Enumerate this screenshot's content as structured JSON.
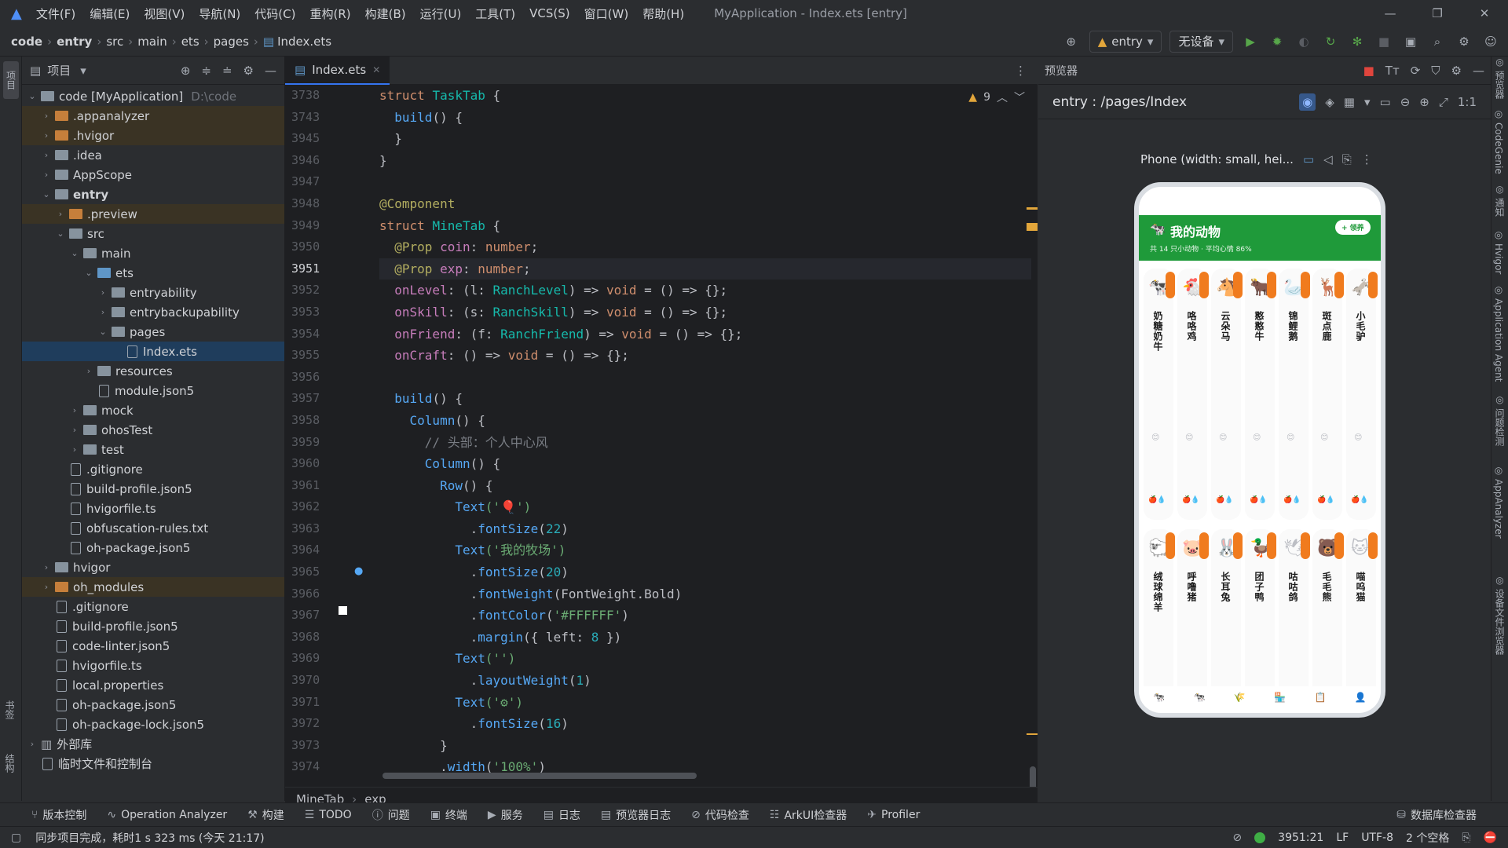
{
  "menu": {
    "items": [
      "文件(F)",
      "编辑(E)",
      "视图(V)",
      "导航(N)",
      "代码(C)",
      "重构(R)",
      "构建(B)",
      "运行(U)",
      "工具(T)",
      "VCS(S)",
      "窗口(W)",
      "帮助(H)"
    ],
    "title": "MyApplication - Index.ets [entry]"
  },
  "breadcrumb": {
    "items": [
      "code",
      "entry",
      "src",
      "main",
      "ets",
      "pages",
      "Index.ets"
    ]
  },
  "toolbar": {
    "run_config": "entry",
    "device": "无设备"
  },
  "project": {
    "header": "项目",
    "rows": [
      {
        "label": "code [MyApplication]",
        "extra": "D:\\code",
        "depth": 0,
        "chev": "v",
        "type": "folder"
      },
      {
        "label": ".appanalyzer",
        "depth": 1,
        "chev": ">",
        "type": "folder-o",
        "hl": true
      },
      {
        "label": ".hvigor",
        "depth": 1,
        "chev": ">",
        "type": "folder-o",
        "hl": true
      },
      {
        "label": ".idea",
        "depth": 1,
        "chev": ">",
        "type": "folder"
      },
      {
        "label": "AppScope",
        "depth": 1,
        "chev": ">",
        "type": "folder"
      },
      {
        "label": "entry",
        "depth": 1,
        "chev": "v",
        "type": "folder",
        "bold": true
      },
      {
        "label": ".preview",
        "depth": 2,
        "chev": ">",
        "type": "folder-o",
        "hl": true
      },
      {
        "label": "src",
        "depth": 2,
        "chev": "v",
        "type": "folder"
      },
      {
        "label": "main",
        "depth": 3,
        "chev": "v",
        "type": "folder"
      },
      {
        "label": "ets",
        "depth": 4,
        "chev": "v",
        "type": "folder-b"
      },
      {
        "label": "entryability",
        "depth": 5,
        "chev": ">",
        "type": "folder"
      },
      {
        "label": "entrybackupability",
        "depth": 5,
        "chev": ">",
        "type": "folder"
      },
      {
        "label": "pages",
        "depth": 5,
        "chev": "v",
        "type": "folder"
      },
      {
        "label": "Index.ets",
        "depth": 6,
        "chev": "",
        "type": "file",
        "sel": true
      },
      {
        "label": "resources",
        "depth": 4,
        "chev": ">",
        "type": "folder"
      },
      {
        "label": "module.json5",
        "depth": 4,
        "chev": "",
        "type": "file"
      },
      {
        "label": "mock",
        "depth": 3,
        "chev": ">",
        "type": "folder"
      },
      {
        "label": "ohosTest",
        "depth": 3,
        "chev": ">",
        "type": "folder"
      },
      {
        "label": "test",
        "depth": 3,
        "chev": ">",
        "type": "folder"
      },
      {
        "label": ".gitignore",
        "depth": 2,
        "chev": "",
        "type": "file"
      },
      {
        "label": "build-profile.json5",
        "depth": 2,
        "chev": "",
        "type": "file"
      },
      {
        "label": "hvigorfile.ts",
        "depth": 2,
        "chev": "",
        "type": "file"
      },
      {
        "label": "obfuscation-rules.txt",
        "depth": 2,
        "chev": "",
        "type": "file"
      },
      {
        "label": "oh-package.json5",
        "depth": 2,
        "chev": "",
        "type": "file"
      },
      {
        "label": "hvigor",
        "depth": 1,
        "chev": ">",
        "type": "folder"
      },
      {
        "label": "oh_modules",
        "depth": 1,
        "chev": ">",
        "type": "folder-o",
        "hl": true
      },
      {
        "label": ".gitignore",
        "depth": 1,
        "chev": "",
        "type": "file"
      },
      {
        "label": "build-profile.json5",
        "depth": 1,
        "chev": "",
        "type": "file"
      },
      {
        "label": "code-linter.json5",
        "depth": 1,
        "chev": "",
        "type": "file"
      },
      {
        "label": "hvigorfile.ts",
        "depth": 1,
        "chev": "",
        "type": "file"
      },
      {
        "label": "local.properties",
        "depth": 1,
        "chev": "",
        "type": "file"
      },
      {
        "label": "oh-package.json5",
        "depth": 1,
        "chev": "",
        "type": "file"
      },
      {
        "label": "oh-package-lock.json5",
        "depth": 1,
        "chev": "",
        "type": "file"
      },
      {
        "label": "外部库",
        "depth": 0,
        "chev": ">",
        "type": "lib"
      },
      {
        "label": "临时文件和控制台",
        "depth": 0,
        "chev": "",
        "type": "file"
      }
    ]
  },
  "editor": {
    "tab": "Index.ets",
    "warnings": "9",
    "footer": [
      "MineTab",
      "exp"
    ],
    "lines": [
      "3738",
      "3743",
      "3945",
      "3946",
      "3947",
      "3948",
      "3949",
      "3950",
      "3951",
      "3952",
      "3953",
      "3954",
      "3955",
      "3956",
      "3957",
      "3958",
      "3959",
      "3960",
      "3961",
      "3962",
      "3963",
      "3964",
      "3965",
      "3966",
      "3967",
      "3968",
      "3969",
      "3970",
      "3971",
      "3972",
      "3973",
      "3974"
    ],
    "current": "3951"
  },
  "preview": {
    "title": "预览器",
    "path": "entry : /pages/Index",
    "device": "Phone (width: small, hei...",
    "app": {
      "title": "我的动物",
      "subtitle": "共 14 只小动物 · 平均心情 86%",
      "button": "+ 领养",
      "row1": [
        {
          "name": "奶糖奶牛",
          "emoji": "🐄"
        },
        {
          "name": "咯咯鸡",
          "emoji": "🐔"
        },
        {
          "name": "云朵马",
          "emoji": "🐴"
        },
        {
          "name": "憨憨牛",
          "emoji": "🐂"
        },
        {
          "name": "锦鲤鹅",
          "emoji": "🦢"
        },
        {
          "name": "斑点鹿",
          "emoji": "🦌"
        },
        {
          "name": "小毛驴",
          "emoji": "🫏"
        }
      ],
      "row2": [
        {
          "name": "绒球绵羊",
          "emoji": "🐑"
        },
        {
          "name": "呼噜猪",
          "emoji": "🐷"
        },
        {
          "name": "长耳兔",
          "emoji": "🐰"
        },
        {
          "name": "团子鸭",
          "emoji": "🦆"
        },
        {
          "name": "咕咕鸽",
          "emoji": "🕊"
        },
        {
          "name": "毛毛熊",
          "emoji": "🐻"
        },
        {
          "name": "喵呜猫",
          "emoji": "🐱"
        }
      ]
    }
  },
  "bottom": {
    "items": [
      "版本控制",
      "Operation Analyzer",
      "构建",
      "TODO",
      "问题",
      "终端",
      "服务",
      "日志",
      "预览器日志",
      "代码检查",
      "ArkUI检查器",
      "Profiler"
    ],
    "right": "数据库检查器"
  },
  "status": {
    "message": "同步项目完成，耗时1 s 323 ms (今天 21:17)",
    "position": "3951:21",
    "eol": "LF",
    "encoding": "UTF-8",
    "indent": "2 个空格"
  },
  "right_strip": [
    "预览器",
    "CodeGenie",
    "通知",
    "Hvigor",
    "Application Agent",
    "问题检测",
    "AppAnalyzer",
    "设备文件浏览器"
  ],
  "left_strip": [
    "项目",
    "书签",
    "结构"
  ]
}
